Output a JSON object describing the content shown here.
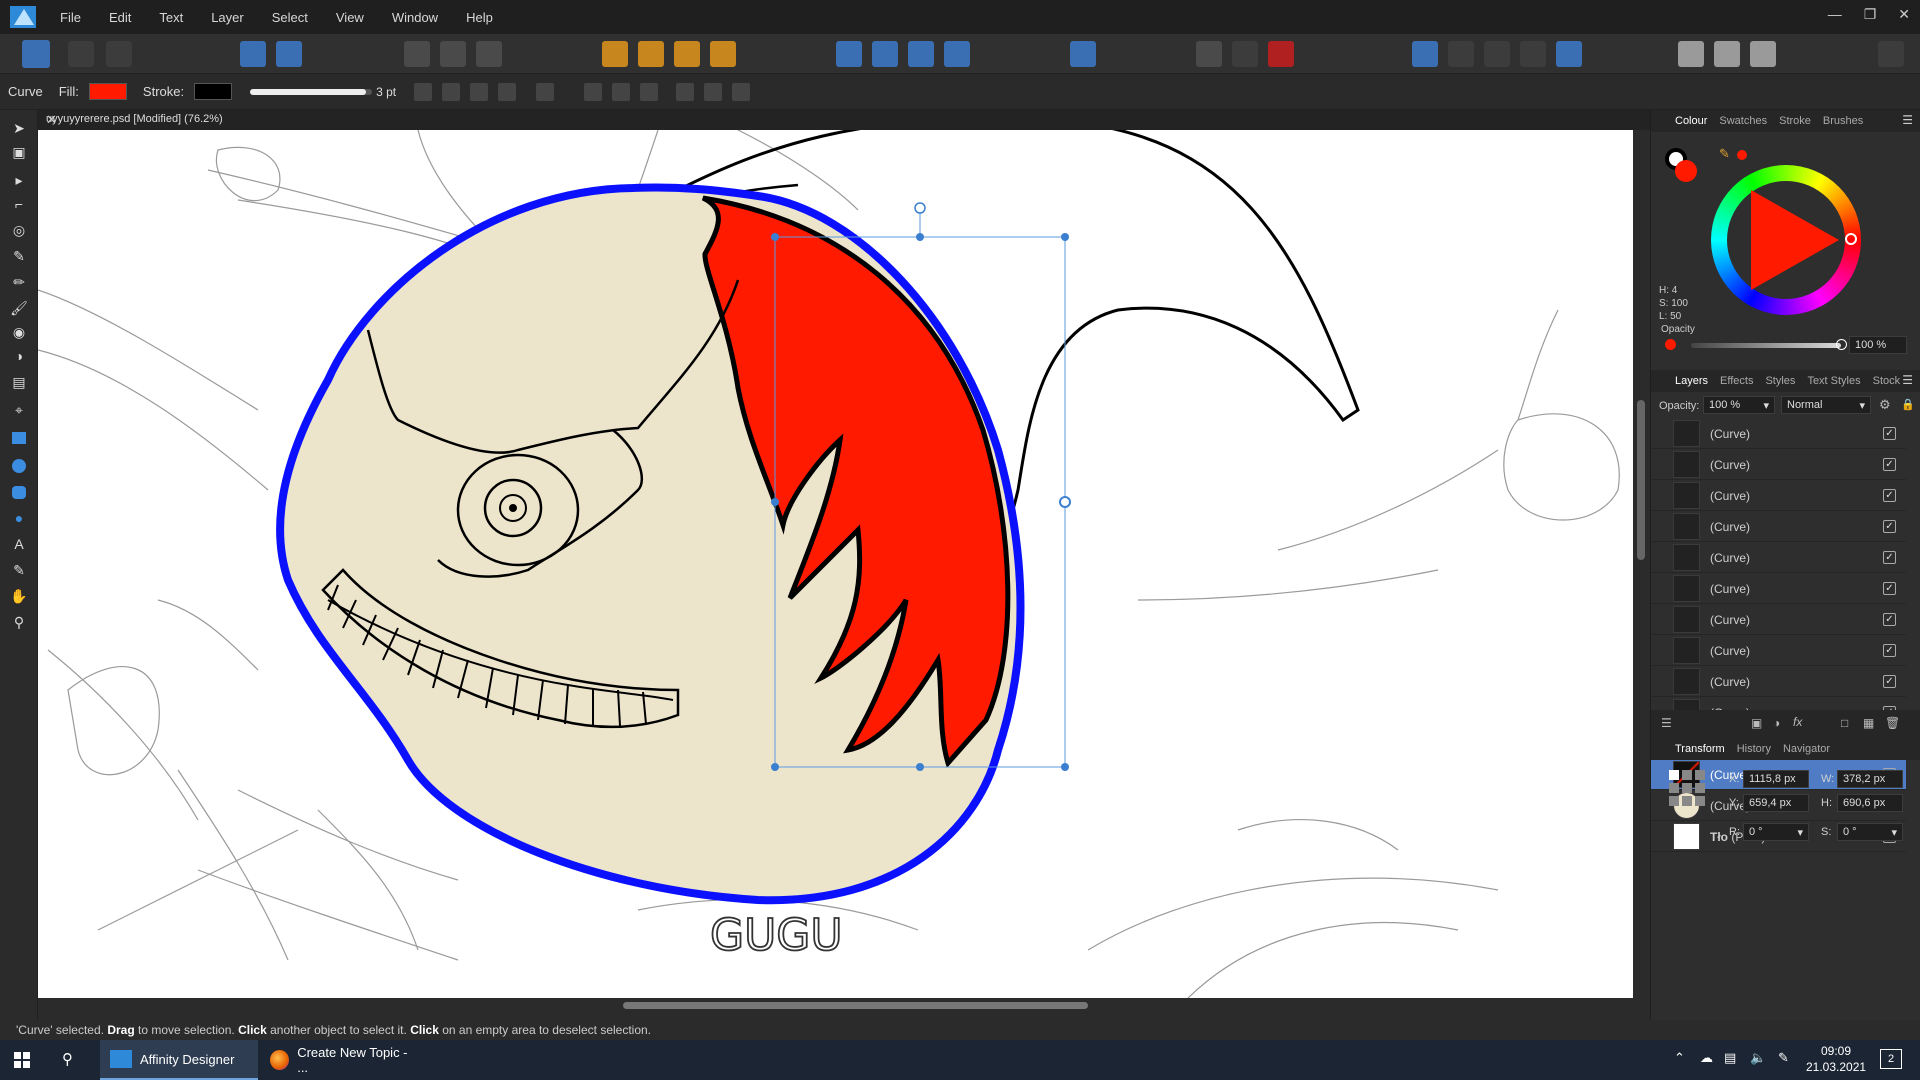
{
  "menubar": {
    "items": [
      "File",
      "Edit",
      "Text",
      "Layer",
      "Select",
      "View",
      "Window",
      "Help"
    ]
  },
  "context": {
    "curve_label": "Curve",
    "fill_label": "Fill:",
    "fill_color": "#ff1a00",
    "stroke_label": "Stroke:",
    "stroke_color": "#000000",
    "stroke_width": "3 pt",
    "stroke_slider_fraction": 0.95
  },
  "document": {
    "tab_title": "uyyuyyrerere.psd [Modified] (76.2%)"
  },
  "artwork": {
    "text": "GUGU"
  },
  "colour_panel": {
    "tabs": [
      "Colour",
      "Swatches",
      "Stroke",
      "Brushes"
    ],
    "h": "H: 4",
    "s": "S: 100",
    "l": "L: 50",
    "opacity_label": "Opacity",
    "opacity_value": "100 %",
    "current_color": "#ff1a00"
  },
  "layers_panel": {
    "tabs": [
      "Layers",
      "Effects",
      "Styles",
      "Text Styles",
      "Stock"
    ],
    "opacity_label": "Opacity:",
    "opacity_value": "100 %",
    "blend_mode": "Normal",
    "layers": [
      {
        "name": "(Curve)",
        "checked": "✓"
      },
      {
        "name": "(Curve)",
        "checked": "✓"
      },
      {
        "name": "(Curve)",
        "checked": "✓"
      },
      {
        "name": "(Curve)",
        "checked": "✓"
      },
      {
        "name": "(Curve)",
        "checked": "✓"
      },
      {
        "name": "(Curve)",
        "checked": "✓"
      },
      {
        "name": "(Curve)",
        "checked": "✓"
      },
      {
        "name": "(Curve)",
        "checked": "✓"
      },
      {
        "name": "(Curve)",
        "checked": "✓"
      },
      {
        "name": "(Curve)",
        "checked": "✓"
      },
      {
        "name": "(Curve)",
        "checked": "✓"
      },
      {
        "name": "(Curve)",
        "checked": "✓",
        "selected": true
      },
      {
        "name": "(Curve)",
        "checked": "✓"
      }
    ],
    "background_layer": {
      "name": "Tło",
      "type": "(Pixel)",
      "checked": "✓"
    }
  },
  "transform_panel": {
    "tabs": [
      "Transform",
      "History",
      "Navigator"
    ],
    "x_label": "X:",
    "x_value": "1115,8 px",
    "y_label": "Y:",
    "y_value": "659,4 px",
    "w_label": "W:",
    "w_value": "378,2 px",
    "h_label": "H:",
    "h_value": "690,6 px",
    "r_label": "R:",
    "r_value": "0 °",
    "s_label": "S:",
    "s_value": "0 °"
  },
  "status": {
    "pre": "'Curve' selected.",
    "drag": "Drag",
    "t1": "to move selection.",
    "click1": "Click",
    "t2": "another object to select it.",
    "click2": "Click",
    "t3": "on an empty area to deselect selection."
  },
  "taskbar": {
    "app1": "Affinity Designer",
    "app2": "Create New Topic - ...",
    "time": "09:09",
    "date": "21.03.2021",
    "notifications": "2"
  }
}
